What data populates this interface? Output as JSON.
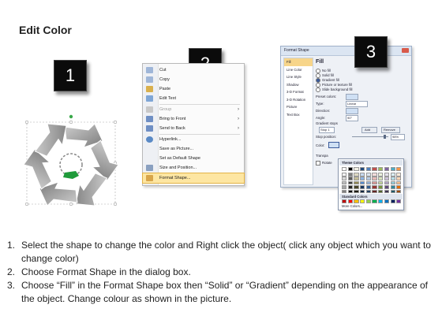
{
  "title": "Edit Color",
  "badges": [
    "1",
    "2",
    "3"
  ],
  "context_menu": {
    "items": [
      {
        "label": "Cut",
        "icon": "scissors-icon",
        "color": "#9fb6d8"
      },
      {
        "label": "Copy",
        "icon": "copy-icon",
        "color": "#9fb6d8"
      },
      {
        "label": "Paste",
        "icon": "paste-icon",
        "color": "#d9b04d"
      },
      {
        "label": "Edit Text",
        "icon": "edit-text-icon",
        "color": "#7fa6d6"
      },
      {
        "label": "Group",
        "icon": "group-icon",
        "color": "#c8c8c8",
        "disabled": true,
        "submenu": true
      },
      {
        "label": "Bring to Front",
        "icon": "bring-to-front-icon",
        "color": "#6f8fc4",
        "submenu": true
      },
      {
        "label": "Send to Back",
        "icon": "send-to-back-icon",
        "color": "#6f8fc4",
        "submenu": true
      },
      {
        "label": "Hyperlink...",
        "icon": "globe-icon",
        "color": "#5a8ac6"
      },
      {
        "label": "Save as Picture...",
        "icon": "",
        "color": ""
      },
      {
        "label": "Set as Default Shape",
        "icon": "",
        "color": ""
      },
      {
        "label": "Size and Position...",
        "icon": "size-position-icon",
        "color": "#8aa0c0"
      },
      {
        "label": "Format Shape...",
        "icon": "format-shape-icon",
        "color": "#d8a54a",
        "highlighted": true
      }
    ]
  },
  "dialog": {
    "title": "Format Shape",
    "nav": [
      "Fill",
      "Line Color",
      "Line Style",
      "Shadow",
      "3-D Format",
      "3-D Rotation",
      "Picture",
      "Text Box"
    ],
    "nav_selected": "Fill",
    "pane_title": "Fill",
    "options": [
      {
        "label": "No fill",
        "checked": false
      },
      {
        "label": "Solid fill",
        "checked": false
      },
      {
        "label": "Gradient fill",
        "checked": true
      },
      {
        "label": "Picture or texture fill",
        "checked": false
      },
      {
        "label": "Slide background fill",
        "checked": false
      }
    ],
    "preset_colors_label": "Preset colors:",
    "type_label": "Type:",
    "type_value": "Linear",
    "direction_label": "Direction:",
    "angle_label": "Angle:",
    "angle_value": "90°",
    "gradient_stops_label": "Gradient stops",
    "stop_value": "Stop 1",
    "add_label": "Add",
    "remove_label": "Remove",
    "stop_position_label": "Stop position:",
    "stop_position_value": "98%",
    "color_label": "Color:",
    "transparency_label": "Transpa",
    "rotate_label": "Rotate"
  },
  "palette": {
    "theme_header": "Theme Colors",
    "standard_header": "Standard Colors",
    "more_label": "More Colors...",
    "theme_top": [
      "#ffffff",
      "#000000",
      "#eeece1",
      "#1f497d",
      "#4f81bd",
      "#c0504d",
      "#9bbb59",
      "#8064a2",
      "#4bacc6",
      "#f79646"
    ],
    "theme_grid": [
      [
        "#f2f2f2",
        "#7f7f7f",
        "#ddd9c3",
        "#c6d9f0",
        "#dbe5f1",
        "#f2dcdb",
        "#ebf1dd",
        "#e5e0ec",
        "#dbeef3",
        "#fdeada"
      ],
      [
        "#d8d8d8",
        "#595959",
        "#c4bd97",
        "#8db3e2",
        "#b8cce4",
        "#e5b9b7",
        "#d7e3bc",
        "#ccc1d9",
        "#b7dde8",
        "#fbd5b5"
      ],
      [
        "#bfbfbf",
        "#3f3f3f",
        "#938953",
        "#548dd4",
        "#95b3d7",
        "#d99694",
        "#c3d69b",
        "#b2a2c7",
        "#92cddc",
        "#fac08f"
      ],
      [
        "#a5a5a5",
        "#262626",
        "#494429",
        "#17365d",
        "#366092",
        "#953734",
        "#76923c",
        "#5f497a",
        "#31859b",
        "#e36c09"
      ],
      [
        "#7f7f7f",
        "#0c0c0c",
        "#1d1b10",
        "#0f243e",
        "#244061",
        "#632423",
        "#4f6128",
        "#3f3151",
        "#205867",
        "#974806"
      ]
    ],
    "standard": [
      "#c00000",
      "#ff0000",
      "#ffc000",
      "#ffff00",
      "#92d050",
      "#00b050",
      "#00b0f0",
      "#0070c0",
      "#002060",
      "#7030a0"
    ]
  },
  "instructions": [
    {
      "num": "1.",
      "text": "Select the shape to change the color and Right click the object( click any object which you want to change color)"
    },
    {
      "num": "2.",
      "text": "Choose Format Shape in the dialog box."
    },
    {
      "num": "3.",
      "text": "Choose “Fill” in the Format Shape box then “Solid” or “Gradient” depending on the appearance of the object. Change colour as shown in the picture."
    }
  ],
  "colors": {
    "arrow_gray": "#9a9a9a",
    "accent_green": "#1f9a3a",
    "highlight": "#fde6a2"
  }
}
